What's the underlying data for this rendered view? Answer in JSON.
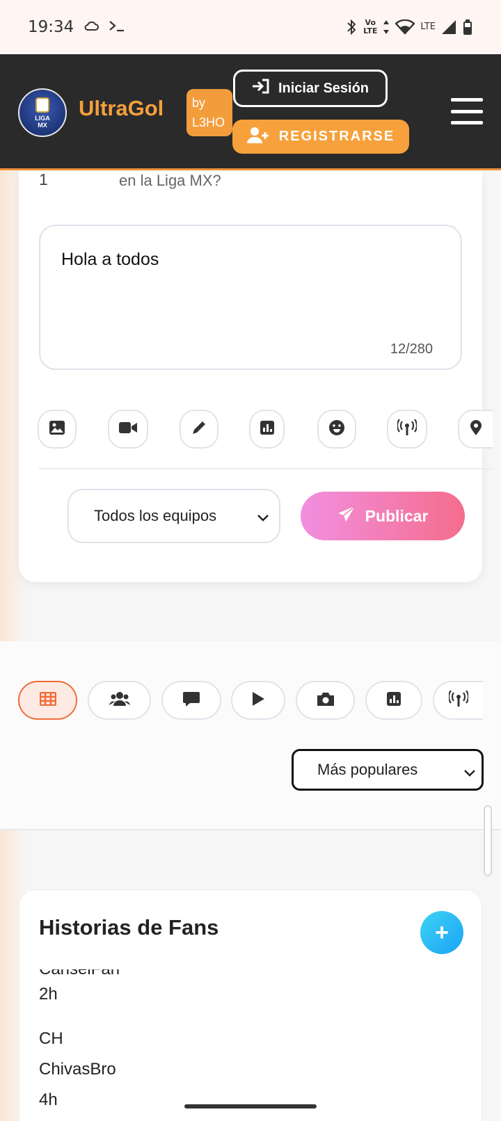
{
  "status_bar": {
    "time": "19:34",
    "net_top": "Vo",
    "net_bottom": "LTE",
    "lte": "LTE"
  },
  "header": {
    "logo_text_1": "LIGA",
    "logo_text_2": "MX",
    "brand": "UltraGol",
    "by_line1": "by",
    "by_line2": "L3HO",
    "login_label": "Iniciar Sesión",
    "register_label": "REGISTRARSE"
  },
  "composer": {
    "question_number": "1",
    "question_text": "en la Liga MX?",
    "text_value": "Hola a todos",
    "char_count": "12/280",
    "tools": [
      "image-icon",
      "video-icon",
      "pencil-icon",
      "chart-icon",
      "emoji-icon",
      "broadcast-icon",
      "location-icon"
    ],
    "team_select": "Todos los equipos",
    "publish_label": "Publicar"
  },
  "filters": {
    "tabs": [
      "grid-icon",
      "users-icon",
      "comment-icon",
      "play-icon",
      "camera-icon",
      "chart-icon",
      "broadcast-icon"
    ],
    "active_tab": 0,
    "sort_select": "Más populares"
  },
  "stories": {
    "title": "Historias de Fans",
    "add_label": "+",
    "partial_name": "CanselFan",
    "items": [
      {
        "time": "2h"
      },
      {
        "initials": "CH",
        "name": "ChivasBro",
        "time": "4h"
      }
    ]
  },
  "colors": {
    "header_bg": "#2a2a2a",
    "brand_orange": "#f3a03d",
    "publish_gradient_start": "#f28fe0",
    "publish_gradient_end": "#f46d8d",
    "active_tab_border": "#f26b3a",
    "add_button": "#1aa3f5"
  }
}
